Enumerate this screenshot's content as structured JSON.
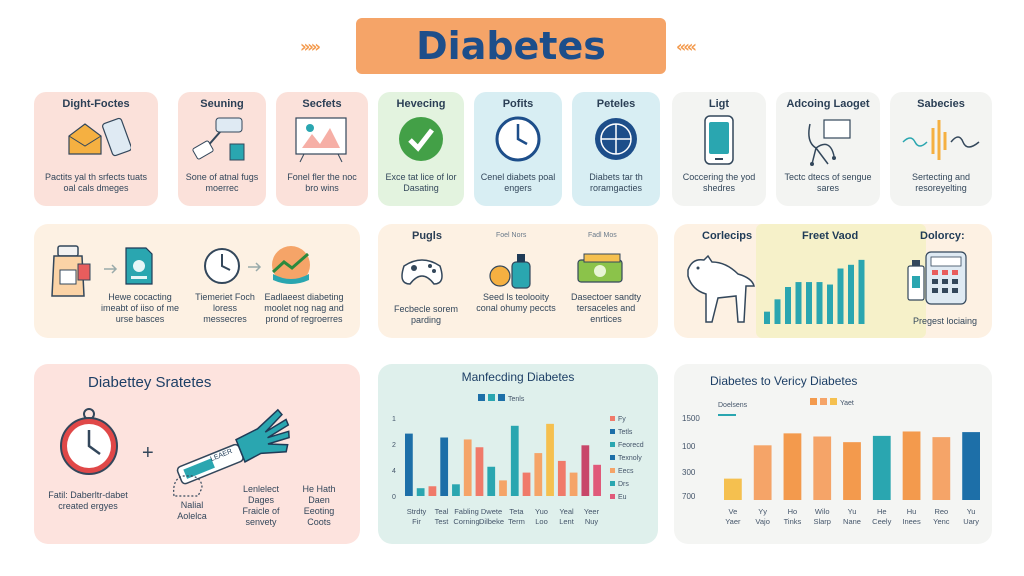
{
  "title": "Diabetes",
  "top_cards": [
    {
      "title": "Dight-Foctes",
      "text": "Pactits yal th srfects tuats oal cals dmeges",
      "bg": "#fbe1da",
      "icon": "envelope-icon"
    },
    {
      "title": "Seuning",
      "text": "Sone of atnal fugs moerrec",
      "bg": "#fbe1da",
      "icon": "syringe-icon"
    },
    {
      "title": "Secfets",
      "text": "Fonel fler the noc bro wins",
      "bg": "#fbe1da",
      "icon": "whiteboard-icon"
    },
    {
      "title": "Hevecing",
      "text": "Exce tat lice of lor Dasating",
      "bg": "#e3f3df",
      "icon": "checkmark-icon"
    },
    {
      "title": "Pofits",
      "text": "Cenel diabets poal engers",
      "bg": "#d8eef3",
      "icon": "clock-icon"
    },
    {
      "title": "Peteles",
      "text": "Diabets tar th roramgacties",
      "bg": "#d8eef3",
      "icon": "globe-icon"
    },
    {
      "title": "Ligt",
      "text": "Coccering the yod shedres",
      "bg": "#f3f4f2",
      "icon": "phone-icon"
    },
    {
      "title": "Adcoing Laoget",
      "text": "Tectc dtecs of sengue sares",
      "bg": "#f3f4f2",
      "icon": "stand-icon"
    },
    {
      "title": "Sabecies",
      "text": "Sertecting and resoreyelting",
      "bg": "#f3f4f2",
      "icon": "waveform-icon"
    }
  ],
  "middle_left": {
    "items": [
      {
        "text": "Hewe cocacting imeabt of iiso of me urse basces"
      },
      {
        "text": "Tiemeriet Foch loress messecres"
      },
      {
        "text": "Eadlaeest diabeting moolet nog nag and prond of regroerres"
      }
    ]
  },
  "middle_center": {
    "title": "Pugls",
    "sub1": "Foel Nors",
    "sub2": "Fadl Mos",
    "items": [
      {
        "text": "Fecbecle sorem parding"
      },
      {
        "text": "Seed ls teolooity conal ohumy peccts"
      },
      {
        "text": "Dasectoer sandty tersaceles and enrtices"
      }
    ]
  },
  "middle_right": {
    "label1": "Corlecips",
    "label2": "Freet Vaod",
    "label3": "Dolorcy:",
    "caption": "Pregest lociaing",
    "chart_data": {
      "type": "bar",
      "values": [
        1,
        2,
        3,
        3.4,
        3.4,
        3.4,
        3.2,
        4.5,
        4.8,
        5.2
      ],
      "ylim": [
        0,
        6
      ]
    }
  },
  "bottom_left": {
    "title": "Diabettey Sratetes",
    "plus": "+",
    "cap1": "Fatil: Daberltr-dabet created ergyes",
    "cap2": "Nalial Aolelca",
    "cap3": "Lenlelect Dages Fraicle of senvety",
    "cap4": "He Hath Daen Eeoting Coots",
    "band": "LEAER"
  },
  "bottom_center": {
    "title": "Manfecding Diabetes",
    "chart_data": {
      "type": "bar",
      "legend_top": "Tenls",
      "legend_right": [
        "Fy",
        "Tetls",
        "Feorecd",
        "Texnoly",
        "Eecs",
        "Drs",
        "Eu"
      ],
      "y_ticks": [
        "1",
        "2",
        "4",
        "0"
      ],
      "categories": [
        "Strdty Fir",
        "Teal Test",
        "Fabling Corning",
        "Dwete Dilbeke",
        "Teta Term",
        "Yuo Loo",
        "Yeal Lent",
        "Yeer Nuy"
      ],
      "values": [
        3.2,
        0.4,
        0.5,
        3.0,
        0.6,
        2.9,
        2.5,
        1.5,
        0.8,
        3.6,
        1.2,
        2.2,
        3.7,
        1.8,
        1.2,
        2.6,
        1.6
      ],
      "colors": [
        "#1d6fa8",
        "#2aa6b0",
        "#f07a6a",
        "#1d6fa8",
        "#2aa6b0",
        "#f5a468",
        "#f07a6a",
        "#2aa6b0",
        "#f5a468",
        "#2aa6b0",
        "#f07a6a",
        "#f5a468",
        "#f5c04f",
        "#f07a6a",
        "#f5a468",
        "#c8476a",
        "#e05a7a"
      ],
      "ylim": [
        0,
        4
      ]
    }
  },
  "bottom_right": {
    "title": "Diabetes to Vericy Diabetes",
    "chart_data": {
      "type": "bar",
      "legend_left": "Doelsens",
      "legend_top": "Yaet",
      "y_ticks": [
        "1500",
        "100",
        "300",
        "700"
      ],
      "categories": [
        "Ve Yaer",
        "Yy Vajo",
        "Ho Tinks",
        "Wilo Slarp",
        "Yu Nane",
        "He Ceely",
        "Hu Inees",
        "Reo Yenc",
        "Yu Uary"
      ],
      "values": [
        340,
        870,
        1060,
        1010,
        920,
        1020,
        1090,
        1000,
        1080
      ],
      "colors": [
        "#f5c04f",
        "#f5a468",
        "#f39a4d",
        "#f5a468",
        "#f39a4d",
        "#2aa6b0",
        "#f39a4d",
        "#f5a468",
        "#1d6fa8"
      ],
      "ylim": [
        0,
        1500
      ]
    }
  }
}
